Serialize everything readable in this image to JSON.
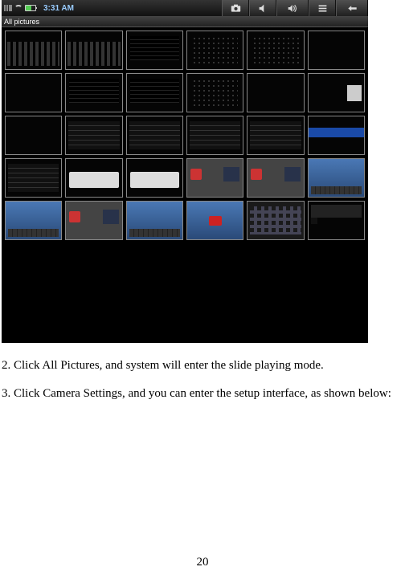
{
  "statusbar": {
    "time": "3:31 AM"
  },
  "titlebar": {
    "label": "All pictures"
  },
  "toolbar_buttons": {
    "camera": "camera",
    "vol_down": "volume-down",
    "vol_up": "volume-up",
    "menu": "menu",
    "back": "back"
  },
  "instructions": {
    "step2": "2. Click All Pictures, and system will enter the slide playing mode.",
    "step3": "3. Click Camera Settings, and you can enter the setup interface, as shown below:"
  },
  "page_number": "20",
  "thumbnails": [
    {
      "v": "t-bars"
    },
    {
      "v": "t-bars"
    },
    {
      "v": "t-lines"
    },
    {
      "v": "t-dots"
    },
    {
      "v": "t-dots"
    },
    {
      "v": ""
    },
    {
      "v": ""
    },
    {
      "v": "t-lines"
    },
    {
      "v": "t-lines"
    },
    {
      "v": "t-dots"
    },
    {
      "v": ""
    },
    {
      "v": "t-card"
    },
    {
      "v": ""
    },
    {
      "v": "t-list"
    },
    {
      "v": "t-list"
    },
    {
      "v": "t-list"
    },
    {
      "v": "t-list"
    },
    {
      "v": "t-bluebar"
    },
    {
      "v": "t-list"
    },
    {
      "v": "t-dialog"
    },
    {
      "v": "t-dialog"
    },
    {
      "v": "t-widget"
    },
    {
      "v": "t-widget"
    },
    {
      "v": "t-sky"
    },
    {
      "v": "t-sky"
    },
    {
      "v": "t-widget"
    },
    {
      "v": "t-sky"
    },
    {
      "v": "t-red t-sky"
    },
    {
      "v": "t-home"
    },
    {
      "v": "t-strip t-green"
    }
  ]
}
